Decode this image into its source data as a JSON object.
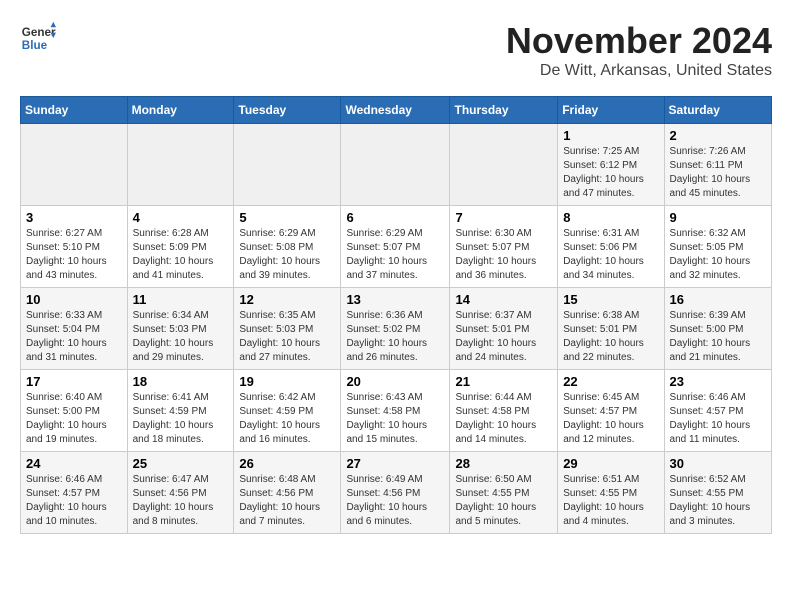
{
  "logo": {
    "general": "General",
    "blue": "Blue"
  },
  "header": {
    "month": "November 2024",
    "location": "De Witt, Arkansas, United States"
  },
  "weekdays": [
    "Sunday",
    "Monday",
    "Tuesday",
    "Wednesday",
    "Thursday",
    "Friday",
    "Saturday"
  ],
  "weeks": [
    [
      {
        "day": "",
        "info": ""
      },
      {
        "day": "",
        "info": ""
      },
      {
        "day": "",
        "info": ""
      },
      {
        "day": "",
        "info": ""
      },
      {
        "day": "",
        "info": ""
      },
      {
        "day": "1",
        "info": "Sunrise: 7:25 AM\nSunset: 6:12 PM\nDaylight: 10 hours and 47 minutes."
      },
      {
        "day": "2",
        "info": "Sunrise: 7:26 AM\nSunset: 6:11 PM\nDaylight: 10 hours and 45 minutes."
      }
    ],
    [
      {
        "day": "3",
        "info": "Sunrise: 6:27 AM\nSunset: 5:10 PM\nDaylight: 10 hours and 43 minutes."
      },
      {
        "day": "4",
        "info": "Sunrise: 6:28 AM\nSunset: 5:09 PM\nDaylight: 10 hours and 41 minutes."
      },
      {
        "day": "5",
        "info": "Sunrise: 6:29 AM\nSunset: 5:08 PM\nDaylight: 10 hours and 39 minutes."
      },
      {
        "day": "6",
        "info": "Sunrise: 6:29 AM\nSunset: 5:07 PM\nDaylight: 10 hours and 37 minutes."
      },
      {
        "day": "7",
        "info": "Sunrise: 6:30 AM\nSunset: 5:07 PM\nDaylight: 10 hours and 36 minutes."
      },
      {
        "day": "8",
        "info": "Sunrise: 6:31 AM\nSunset: 5:06 PM\nDaylight: 10 hours and 34 minutes."
      },
      {
        "day": "9",
        "info": "Sunrise: 6:32 AM\nSunset: 5:05 PM\nDaylight: 10 hours and 32 minutes."
      }
    ],
    [
      {
        "day": "10",
        "info": "Sunrise: 6:33 AM\nSunset: 5:04 PM\nDaylight: 10 hours and 31 minutes."
      },
      {
        "day": "11",
        "info": "Sunrise: 6:34 AM\nSunset: 5:03 PM\nDaylight: 10 hours and 29 minutes."
      },
      {
        "day": "12",
        "info": "Sunrise: 6:35 AM\nSunset: 5:03 PM\nDaylight: 10 hours and 27 minutes."
      },
      {
        "day": "13",
        "info": "Sunrise: 6:36 AM\nSunset: 5:02 PM\nDaylight: 10 hours and 26 minutes."
      },
      {
        "day": "14",
        "info": "Sunrise: 6:37 AM\nSunset: 5:01 PM\nDaylight: 10 hours and 24 minutes."
      },
      {
        "day": "15",
        "info": "Sunrise: 6:38 AM\nSunset: 5:01 PM\nDaylight: 10 hours and 22 minutes."
      },
      {
        "day": "16",
        "info": "Sunrise: 6:39 AM\nSunset: 5:00 PM\nDaylight: 10 hours and 21 minutes."
      }
    ],
    [
      {
        "day": "17",
        "info": "Sunrise: 6:40 AM\nSunset: 5:00 PM\nDaylight: 10 hours and 19 minutes."
      },
      {
        "day": "18",
        "info": "Sunrise: 6:41 AM\nSunset: 4:59 PM\nDaylight: 10 hours and 18 minutes."
      },
      {
        "day": "19",
        "info": "Sunrise: 6:42 AM\nSunset: 4:59 PM\nDaylight: 10 hours and 16 minutes."
      },
      {
        "day": "20",
        "info": "Sunrise: 6:43 AM\nSunset: 4:58 PM\nDaylight: 10 hours and 15 minutes."
      },
      {
        "day": "21",
        "info": "Sunrise: 6:44 AM\nSunset: 4:58 PM\nDaylight: 10 hours and 14 minutes."
      },
      {
        "day": "22",
        "info": "Sunrise: 6:45 AM\nSunset: 4:57 PM\nDaylight: 10 hours and 12 minutes."
      },
      {
        "day": "23",
        "info": "Sunrise: 6:46 AM\nSunset: 4:57 PM\nDaylight: 10 hours and 11 minutes."
      }
    ],
    [
      {
        "day": "24",
        "info": "Sunrise: 6:46 AM\nSunset: 4:57 PM\nDaylight: 10 hours and 10 minutes."
      },
      {
        "day": "25",
        "info": "Sunrise: 6:47 AM\nSunset: 4:56 PM\nDaylight: 10 hours and 8 minutes."
      },
      {
        "day": "26",
        "info": "Sunrise: 6:48 AM\nSunset: 4:56 PM\nDaylight: 10 hours and 7 minutes."
      },
      {
        "day": "27",
        "info": "Sunrise: 6:49 AM\nSunset: 4:56 PM\nDaylight: 10 hours and 6 minutes."
      },
      {
        "day": "28",
        "info": "Sunrise: 6:50 AM\nSunset: 4:55 PM\nDaylight: 10 hours and 5 minutes."
      },
      {
        "day": "29",
        "info": "Sunrise: 6:51 AM\nSunset: 4:55 PM\nDaylight: 10 hours and 4 minutes."
      },
      {
        "day": "30",
        "info": "Sunrise: 6:52 AM\nSunset: 4:55 PM\nDaylight: 10 hours and 3 minutes."
      }
    ]
  ]
}
